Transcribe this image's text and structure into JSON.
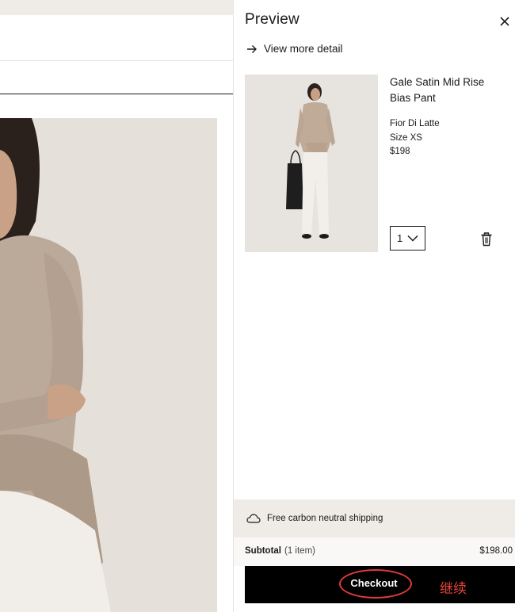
{
  "drawer": {
    "title": "Preview",
    "view_more_label": "View more detail"
  },
  "product": {
    "name": "Gale Satin Mid Rise Bias Pant",
    "color": "Fior Di Latte",
    "size": "Size XS",
    "price": "$198",
    "quantity": "1"
  },
  "shipping": {
    "label": "Free carbon neutral shipping"
  },
  "subtotal": {
    "label": "Subtotal",
    "count": "(1 item)",
    "value": "$198.00"
  },
  "checkout": {
    "label": "Checkout",
    "annotation": "继续"
  },
  "colors": {
    "checkout_bg": "#000000",
    "annotation_red": "#e03a3a",
    "shipping_bg": "#efece7"
  },
  "icons": [
    "close-icon",
    "arrow-right-icon",
    "chevron-down-icon",
    "trash-icon",
    "cloud-icon"
  ]
}
